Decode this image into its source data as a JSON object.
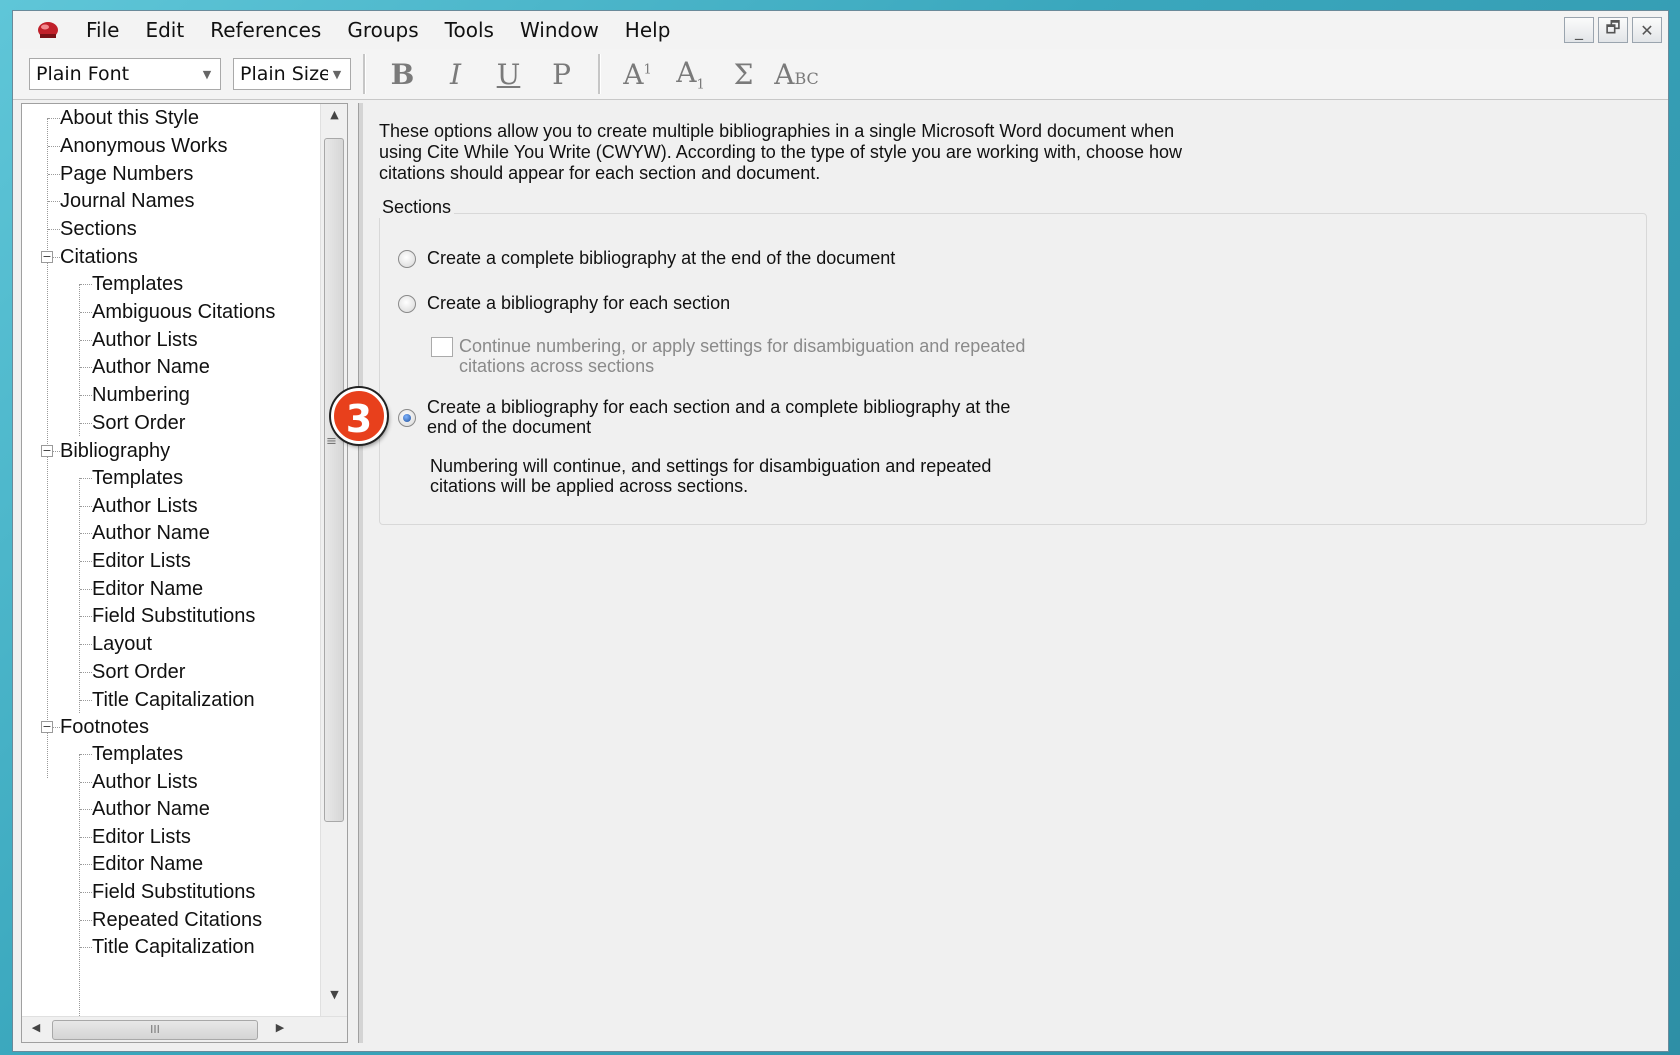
{
  "menu": [
    "File",
    "Edit",
    "References",
    "Groups",
    "Tools",
    "Window",
    "Help"
  ],
  "window_controls": {
    "minimize": "_",
    "restore": "🗗",
    "close": "✕"
  },
  "toolbar": {
    "font_value": "Plain Font",
    "size_value": "Plain Size",
    "bold": "B",
    "italic": "I",
    "underline": "U",
    "plain": "P",
    "superscript_base": "A",
    "superscript_mark": "1",
    "subscript_base": "A",
    "subscript_mark": "1",
    "symbol": "Σ",
    "smallcaps_big": "A",
    "smallcaps_small": "BC"
  },
  "tree": {
    "root_items": [
      "About this Style",
      "Anonymous Works",
      "Page Numbers",
      "Journal Names",
      "Sections"
    ],
    "citations": {
      "label": "Citations",
      "children": [
        "Templates",
        "Ambiguous Citations",
        "Author Lists",
        "Author Name",
        "Numbering",
        "Sort Order"
      ]
    },
    "bibliography": {
      "label": "Bibliography",
      "children": [
        "Templates",
        "Author Lists",
        "Author Name",
        "Editor Lists",
        "Editor Name",
        "Field Substitutions",
        "Layout",
        "Sort Order",
        "Title Capitalization"
      ]
    },
    "footnotes": {
      "label": "Footnotes",
      "children": [
        "Templates",
        "Author Lists",
        "Author Name",
        "Editor Lists",
        "Editor Name",
        "Field Substitutions",
        "Repeated Citations",
        "Title Capitalization"
      ]
    }
  },
  "content": {
    "intro": "These options allow you to create multiple bibliographies in a single Microsoft Word document when using Cite While You Write (CWYW). According to the type of style you are working with, choose how citations should appear for each section and document.",
    "group_label": "Sections",
    "option1": "Create a complete bibliography at the end of the document",
    "option2": "Create a bibliography for each section",
    "checkbox_line1": "Continue numbering, or apply settings for disambiguation and repeated",
    "checkbox_line2": "citations across sections",
    "option3_line1": "Create a bibliography for each section and a complete bibliography at the",
    "option3_line2": "end of the document",
    "note_line1": "Numbering will continue, and settings for disambiguation and repeated",
    "note_line2": "citations will be applied across sections.",
    "selected_option": 3
  },
  "step_badge": "3",
  "colors": {
    "badge": "#e8401c",
    "radio_selected": "#1f4f9a"
  }
}
